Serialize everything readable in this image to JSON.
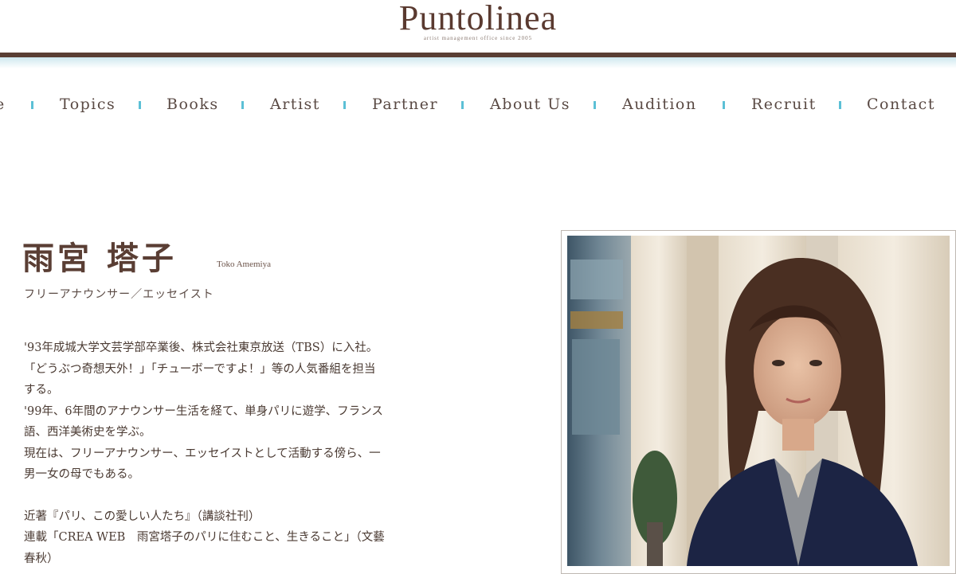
{
  "header": {
    "logo": "Puntolinea",
    "tagline": "artist management office since 2005"
  },
  "nav": {
    "items": [
      {
        "label": "e"
      },
      {
        "label": "Topics"
      },
      {
        "label": "Books"
      },
      {
        "label": "Artist"
      },
      {
        "label": "Partner"
      },
      {
        "label": "About Us"
      },
      {
        "label": "Audition"
      },
      {
        "label": "Recruit"
      },
      {
        "label": "Contact"
      }
    ],
    "separator_color": "#5cc0d6"
  },
  "profile": {
    "name": "雨宮 塔子",
    "romaji": "Toko Amemiya",
    "role": "フリーアナウンサー／エッセイスト",
    "bio": [
      "'93年成城大学文芸学部卒業後、株式会社東京放送（TBS）に入社。",
      "「どうぶつ奇想天外！」「チューボーですよ！」等の人気番組を担当",
      "する。",
      "'99年、6年間のアナウンサー生活を経て、単身パリに遊学、フランス",
      "語、西洋美術史を学ぶ。",
      "現在は、フリーアナウンサー、エッセイストとして活動する傍ら、一",
      "男一女の母でもある。"
    ],
    "works": [
      "近著『パリ、この愛しい人たち』（講談社刊）",
      "連載「CREA WEB　雨宮塔子のパリに住むこと、生きること」（文藝",
      "春秋）"
    ]
  },
  "colors": {
    "brand_brown": "#5a3e34",
    "accent_cyan": "#5cc0d6"
  }
}
